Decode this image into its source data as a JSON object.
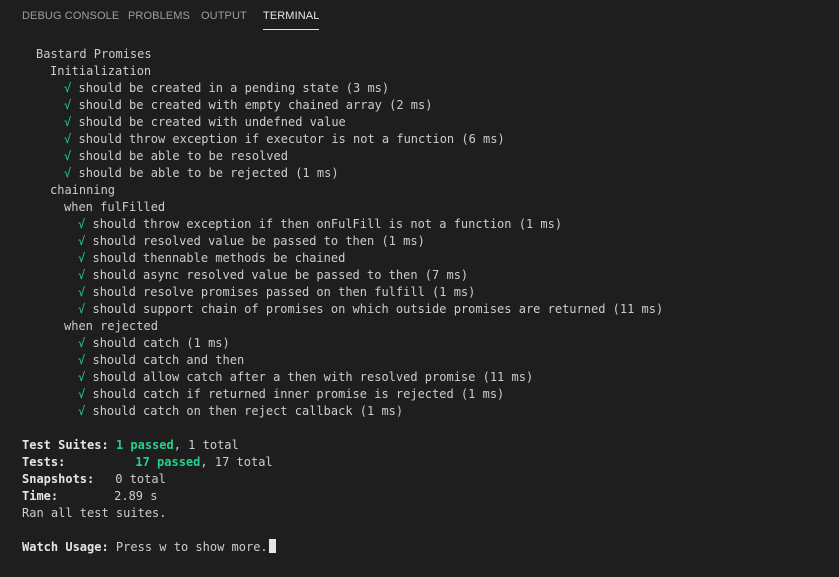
{
  "tabs": [
    {
      "label": "DEBUG CONSOLE"
    },
    {
      "label": "PROBLEMS"
    },
    {
      "label": "OUTPUT"
    },
    {
      "label": "TERMINAL",
      "active": true
    }
  ],
  "suite": {
    "name": "Bastard Promises",
    "groups": [
      {
        "name": "Initialization",
        "tests": [
          "should be created in a pending state (3 ms)",
          "should be created with empty chained array (2 ms)",
          "should be created with undefned value",
          "should throw exception if executor is not a function (6 ms)",
          "should be able to be resolved",
          "should be able to be rejected (1 ms)"
        ]
      },
      {
        "name": "chainning",
        "subgroups": [
          {
            "name": "when fulFilled",
            "tests": [
              "should throw exception if then onFulFill is not a function (1 ms)",
              "should resolved value be passed to then (1 ms)",
              "should thennable methods be chained",
              "should async resolved value be passed to then (7 ms)",
              "should resolve promises passed on then fulfill (1 ms)",
              "should support chain of promises on which outside promises are returned (11 ms)"
            ]
          },
          {
            "name": "when rejected",
            "tests": [
              "should catch (1 ms)",
              "should catch and then",
              "should allow catch after a then with resolved promise (11 ms)",
              "should catch if returned inner promise is rejected (1 ms)",
              "should catch on then reject callback (1 ms)"
            ]
          }
        ]
      }
    ]
  },
  "check_mark": "√",
  "summary": {
    "suites_label": "Test Suites:",
    "suites_passed": "1 passed",
    "suites_rest": ", 1 total",
    "tests_label": "Tests:",
    "tests_passed": "17 passed",
    "tests_rest": ", 17 total",
    "snapshots_label": "Snapshots:",
    "snapshots_value": "0 total",
    "time_label": "Time:",
    "time_value": "2.89 s",
    "ran_all": "Ran all test suites."
  },
  "watch": {
    "label": "Watch Usage:",
    "text": " Press w to show more."
  },
  "colors": {
    "background": "#1e1e1e",
    "pass_green": "#23d18b",
    "text": "#cccccc",
    "active_tab": "#e7e7e7",
    "inactive_tab": "#9d9d9d"
  }
}
